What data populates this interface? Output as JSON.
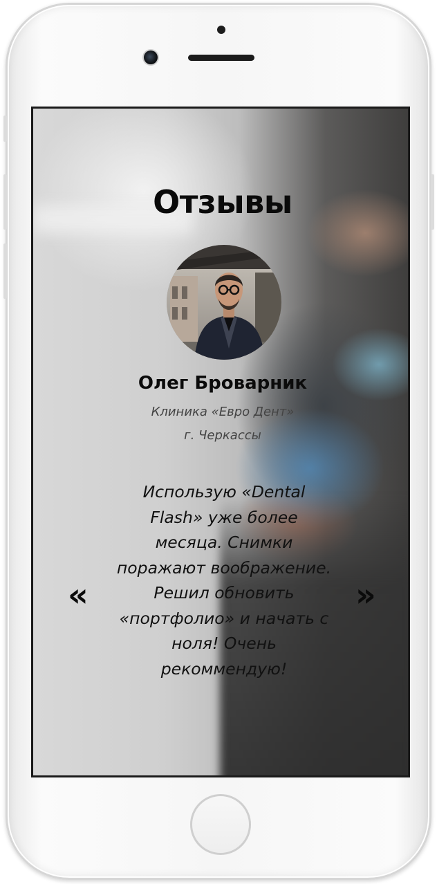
{
  "reviews": {
    "title": "Отзывы",
    "person": {
      "name": "Олег Броварник",
      "clinic": "Клиника «Евро Дент»",
      "city": "г. Черкассы",
      "photo_icon": "portrait-photo"
    },
    "text": "Использую «Dental Flash» уже более месяца. Снимки поражают воображение. Решил обновить «портфолио» и начать с ноля! Очень рекоммендую!",
    "nav": {
      "prev": "«",
      "next": "»"
    }
  }
}
